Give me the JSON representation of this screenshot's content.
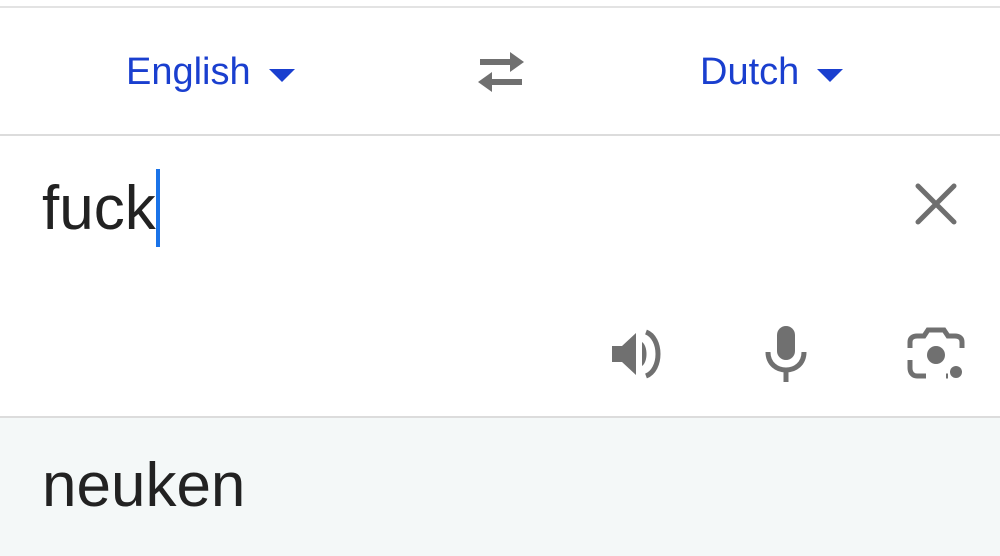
{
  "language_bar": {
    "source_language": "English",
    "target_language": "Dutch",
    "swap_icon": "swap-arrows-icon",
    "dropdown_icon": "caret-down-icon"
  },
  "input": {
    "text": "fuck",
    "clear_icon": "close-icon"
  },
  "toolbar": {
    "listen_icon": "speaker-icon",
    "voice_icon": "microphone-icon",
    "camera_icon": "camera-lens-icon"
  },
  "output": {
    "text": "neuken"
  },
  "colors": {
    "accent": "#1a3fcf",
    "cursor": "#1a73e8",
    "icon": "#707070",
    "output_background": "#f4f8f8"
  }
}
